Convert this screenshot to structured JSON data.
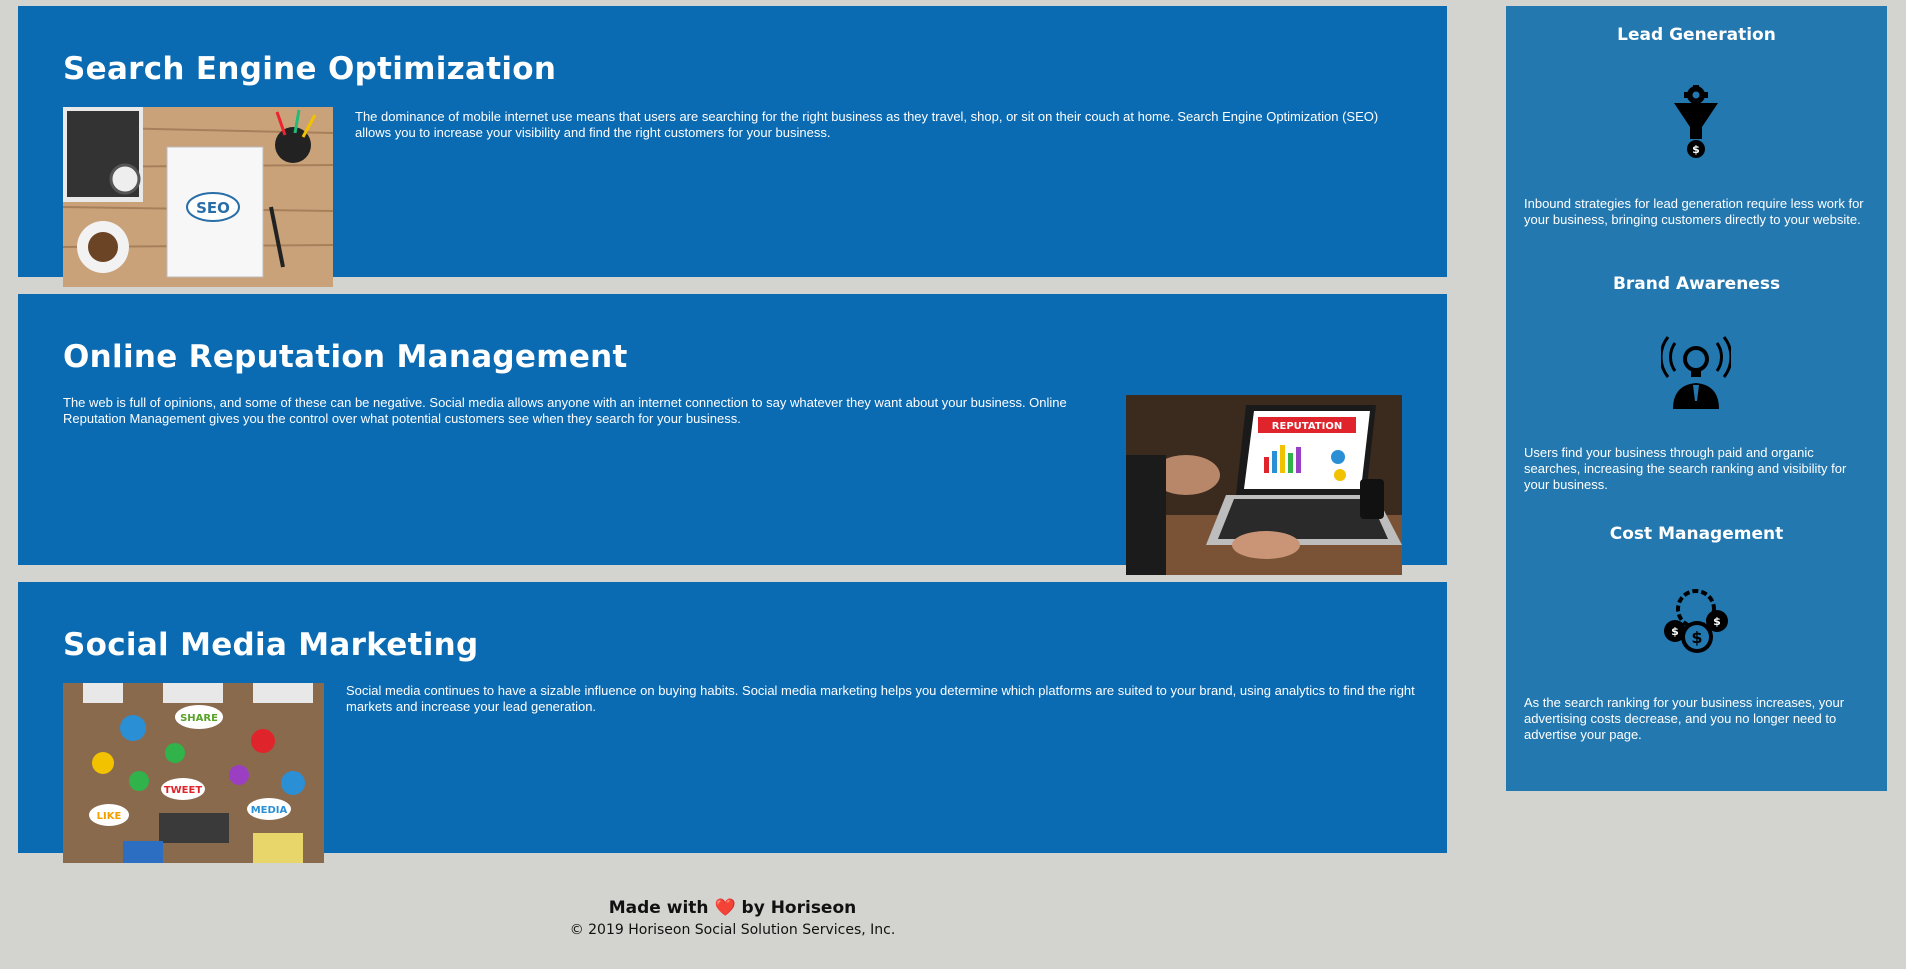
{
  "sections": [
    {
      "title": "Search Engine Optimization",
      "body": "The dominance of mobile internet use means that users are searching for the right business as they travel, shop, or sit on their couch at home. Search Engine Optimization (SEO) allows you to increase your visibility and find the right customers for your business."
    },
    {
      "title": "Online Reputation Management",
      "body": "The web is full of opinions, and some of these can be negative. Social media allows anyone with an internet connection to say whatever they want about your business. Online Reputation Management gives you the control over what potential customers see when they search for your business."
    },
    {
      "title": "Social Media Marketing",
      "body": "Social media continues to have a sizable influence on buying habits. Social media marketing helps you determine which platforms are suited to your brand, using analytics to find the right markets and increase your lead generation."
    }
  ],
  "image_text": {
    "seo": "SEO",
    "reputation": "REPUTATION",
    "share": "SHARE",
    "tweet": "TWEET",
    "like": "LIKE",
    "media": "MEDIA"
  },
  "benefits": [
    {
      "title": "Lead Generation",
      "icon": "funnel-gear-icon",
      "body": "Inbound strategies for lead generation require less work for your business, bringing customers directly to your website."
    },
    {
      "title": "Brand Awareness",
      "icon": "lightbulb-person-icon",
      "body": "Users find your business through paid and organic searches, increasing the search ranking and visibility for your business."
    },
    {
      "title": "Cost Management",
      "icon": "coins-gear-icon",
      "body": "As the search ranking for your business increases, your advertising costs decrease, and you no longer need to advertise your page."
    }
  ],
  "footer": {
    "made_prefix": "Made with",
    "heart": "❤️",
    "made_suffix": "by Horiseon",
    "copyright": "© 2019 Horiseon Social Solution Services, Inc."
  },
  "colors": {
    "background": "#d3d4cf",
    "card": "#0a6ab2",
    "sidebar": "#2378b0",
    "text": "#ffffff"
  }
}
